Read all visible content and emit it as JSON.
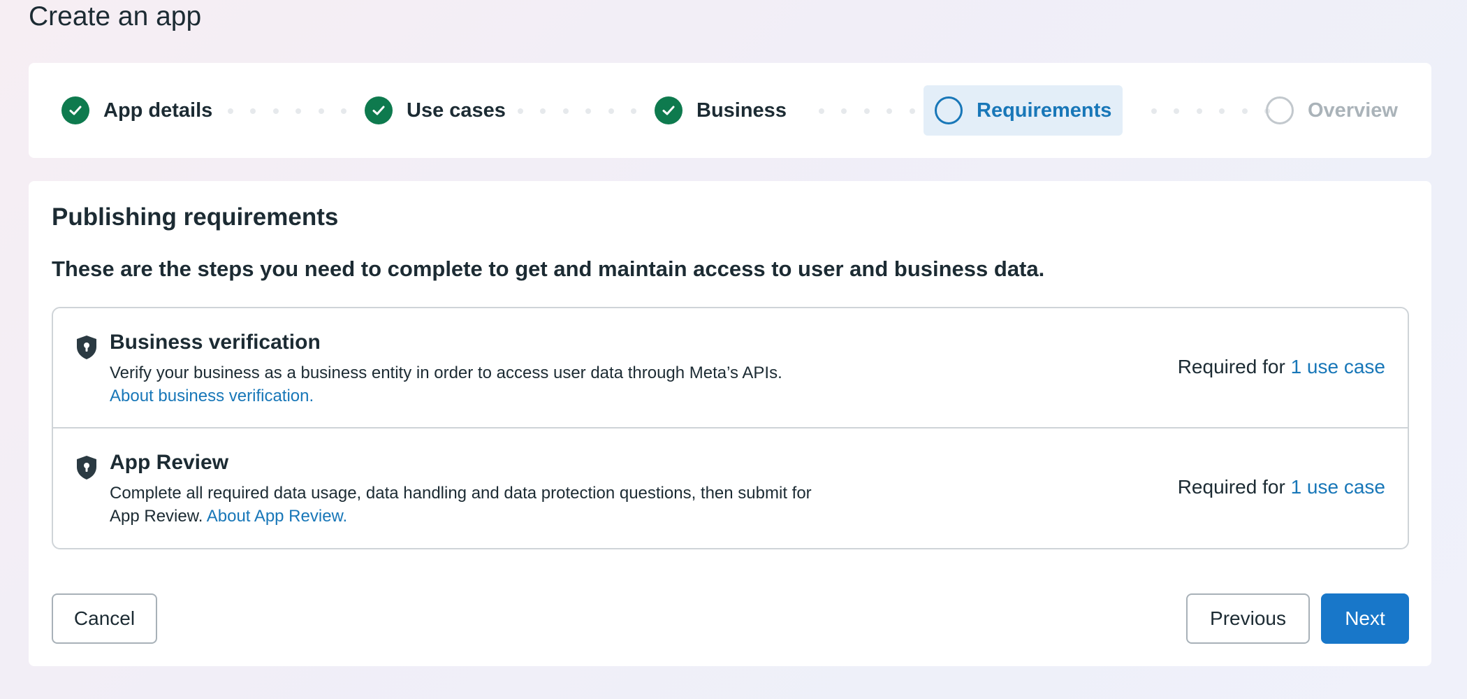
{
  "page": {
    "title": "Create an app"
  },
  "stepper": {
    "steps": [
      {
        "label": "App details",
        "state": "complete"
      },
      {
        "label": "Use cases",
        "state": "complete"
      },
      {
        "label": "Business",
        "state": "complete"
      },
      {
        "label": "Requirements",
        "state": "active"
      },
      {
        "label": "Overview",
        "state": "upcoming"
      }
    ]
  },
  "main": {
    "title": "Publishing requirements",
    "subtitle": "These are the steps you need to complete to get and maintain access to user and business data.",
    "requirements": [
      {
        "icon": "shield-lock-icon",
        "title": "Business verification",
        "description": "Verify your business as a business entity in order to access user data through Meta’s APIs.",
        "link": "About business verification.",
        "required_prefix": "Required for",
        "required_link": "1 use case"
      },
      {
        "icon": "shield-lock-icon",
        "title": "App Review",
        "description": "Complete all required data usage, data handling and data protection questions, then submit for App Review.",
        "link": "About App Review.",
        "required_prefix": "Required for",
        "required_link": "1 use case"
      }
    ]
  },
  "footer": {
    "cancel_label": "Cancel",
    "previous_label": "Previous",
    "next_label": "Next"
  },
  "colors": {
    "accent": "#1877b8",
    "complete": "#0e7a4e",
    "primary_button": "#1877c9",
    "text": "#1c2b33"
  }
}
